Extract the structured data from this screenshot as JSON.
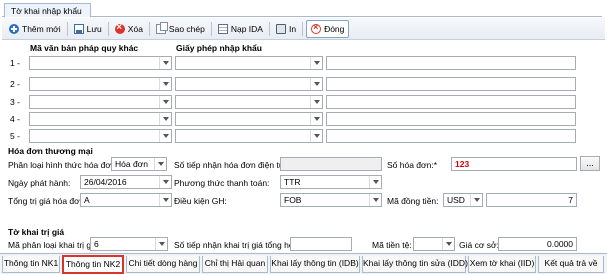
{
  "window_tab": "Tờ khai nhập khẩu",
  "toolbar": {
    "add": "Thêm mới",
    "save": "Lưu",
    "delete": "Xóa",
    "copy": "Sao chép",
    "load_ida": "Nạp IDA",
    "print": "In",
    "close": "Đóng"
  },
  "legal_docs": {
    "col1_header": "Mã văn bản pháp quy khác",
    "col2_header": "Giấy phép nhập khẩu",
    "rows": [
      {
        "label": "1 -"
      },
      {
        "label": "2 -"
      },
      {
        "label": "3 -"
      },
      {
        "label": "4 -"
      },
      {
        "label": "5 -"
      }
    ]
  },
  "invoice": {
    "section_title": "Hóa đơn thương mại",
    "type_label": "Phân loại hình thức hóa đơn:*",
    "type_value": "Hóa đơn",
    "einvoice_label": "Số tiếp nhận hóa đơn điện tử:",
    "einvoice_value": "",
    "number_label": "Số hóa đơn:*",
    "number_value": "123",
    "more_button": "...",
    "issue_date_label": "Ngày phát hành:",
    "issue_date_value": "26/04/2016",
    "payment_label": "Phương thức thanh toán:",
    "payment_value": "TTR",
    "total_label": "Tổng trị giá hóa đơn:",
    "total_value": "A",
    "delivery_label": "Điều kiện GH:",
    "delivery_value": "FOB",
    "currency_label": "Mã đồng tiền:",
    "currency_value": "USD",
    "amount_value": "7"
  },
  "declared_value": {
    "section_title": "Tờ khai trị giá",
    "class_label": "Mã phân loại khai trị giá:",
    "class_value": "6",
    "aggregate_label": "Số tiếp nhận khai trị giá tổng hợp:",
    "aggregate_value": "",
    "currency_label": "Mã tiền tệ:",
    "currency_value": "",
    "base_price_label": "Giá cơ sở:",
    "base_price_value": "0.0000"
  },
  "bottom_tabs": [
    "Thông tin NK1",
    "Thông tin NK2",
    "Chi tiết dòng hàng",
    "Chỉ thị Hải quan",
    "Khai lấy thông tin (IDB)",
    "Khai lấy thông tin sửa (IDD)",
    "Xem tờ khai (IID)",
    "Kết quả trả về"
  ]
}
